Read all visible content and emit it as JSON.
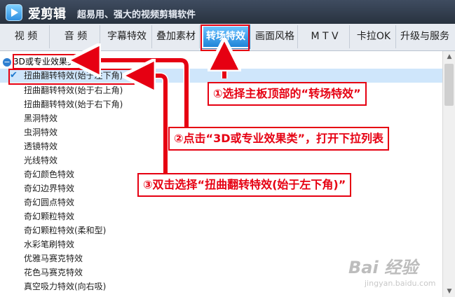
{
  "app": {
    "name": "爱剪辑",
    "slogan": "超易用、强大的视频剪辑软件"
  },
  "tabs": [
    {
      "label": "视 频"
    },
    {
      "label": "音 频"
    },
    {
      "label": "字幕特效"
    },
    {
      "label": "叠加素材"
    },
    {
      "label": "转场特效"
    },
    {
      "label": "画面风格"
    },
    {
      "label": "M T V"
    },
    {
      "label": "卡拉OK"
    },
    {
      "label": "升级与服务"
    }
  ],
  "category": {
    "label": "3D或专业效果类",
    "toggle": "−"
  },
  "effects": [
    "扭曲翻转特效(始于左下角)",
    "扭曲翻转特效(始于右上角)",
    "扭曲翻转特效(始于右下角)",
    "黑洞特效",
    "虫洞特效",
    "透镜特效",
    "光线特效",
    "奇幻颜色特效",
    "奇幻边界特效",
    "奇幻圆点特效",
    "奇幻颗粒特效",
    "奇幻颗粒特效(柔和型)",
    "水彩笔刷特效",
    "优雅马赛克特效",
    "花色马赛克特效",
    "真空吸力特效(向右吸)"
  ],
  "selected_check": "✔",
  "annotations": {
    "step1": "①选择主板顶部的“转场特效”",
    "step2": "②点击“3D或专业效果类”，打开下拉列表",
    "step3": "③双击选择“扭曲翻转特效(始于左下角)”"
  },
  "watermark": {
    "text": "Bai 经验",
    "sub": "jingyan.baidu.com"
  },
  "colors": {
    "accent": "#1f85d8",
    "annotation": "#e60012",
    "selection": "#cfe6fb"
  }
}
